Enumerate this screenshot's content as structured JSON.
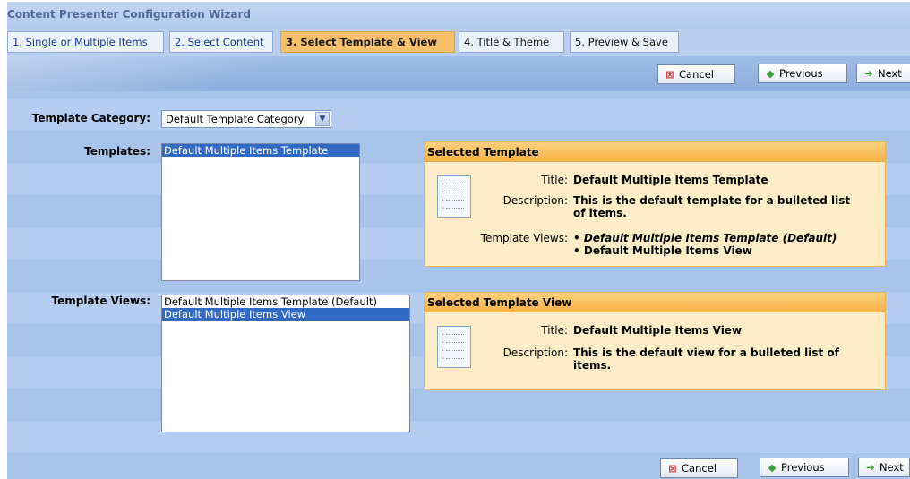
{
  "wizard": {
    "title": "Content Presenter Configuration Wizard"
  },
  "tabs": [
    {
      "label": "1. Single or Multiple Items",
      "state": "link"
    },
    {
      "label": "2. Select Content",
      "state": "link"
    },
    {
      "label": "3. Select Template & View",
      "state": "active"
    },
    {
      "label": "4. Title & Theme",
      "state": "plain"
    },
    {
      "label": "5. Preview & Save",
      "state": "plain"
    }
  ],
  "buttons": {
    "cancel": "Cancel",
    "previous": "Previous",
    "next": "Next"
  },
  "form": {
    "category_label": "Template Category:",
    "category_value": "Default Template Category",
    "templates_label": "Templates:",
    "templates": [
      "Default Multiple Items Template"
    ],
    "templates_selected": 0,
    "views_label": "Template Views:",
    "views": [
      "Default Multiple Items Template (Default)",
      "Default Multiple Items View"
    ],
    "views_selected": 1
  },
  "selected_template": {
    "header": "Selected Template",
    "title_key": "Title:",
    "title": "Default Multiple Items Template",
    "desc_key": "Description:",
    "desc_line1": "This is the default template for a bulleted list",
    "desc_line2": "of items.",
    "views_key": "Template Views:",
    "view1": "Default Multiple Items Template (Default)",
    "view2": "Default Multiple Items View"
  },
  "selected_view": {
    "header": "Selected Template View",
    "title_key": "Title:",
    "title": "Default Multiple Items View",
    "desc_key": "Description:",
    "desc_line1": "This is the default view for a bulleted list of",
    "desc_line2": "items."
  },
  "colors": {
    "active_tab": "#f7c06a",
    "panel_bg": "#fcedc6",
    "selection": "#316ac5"
  }
}
